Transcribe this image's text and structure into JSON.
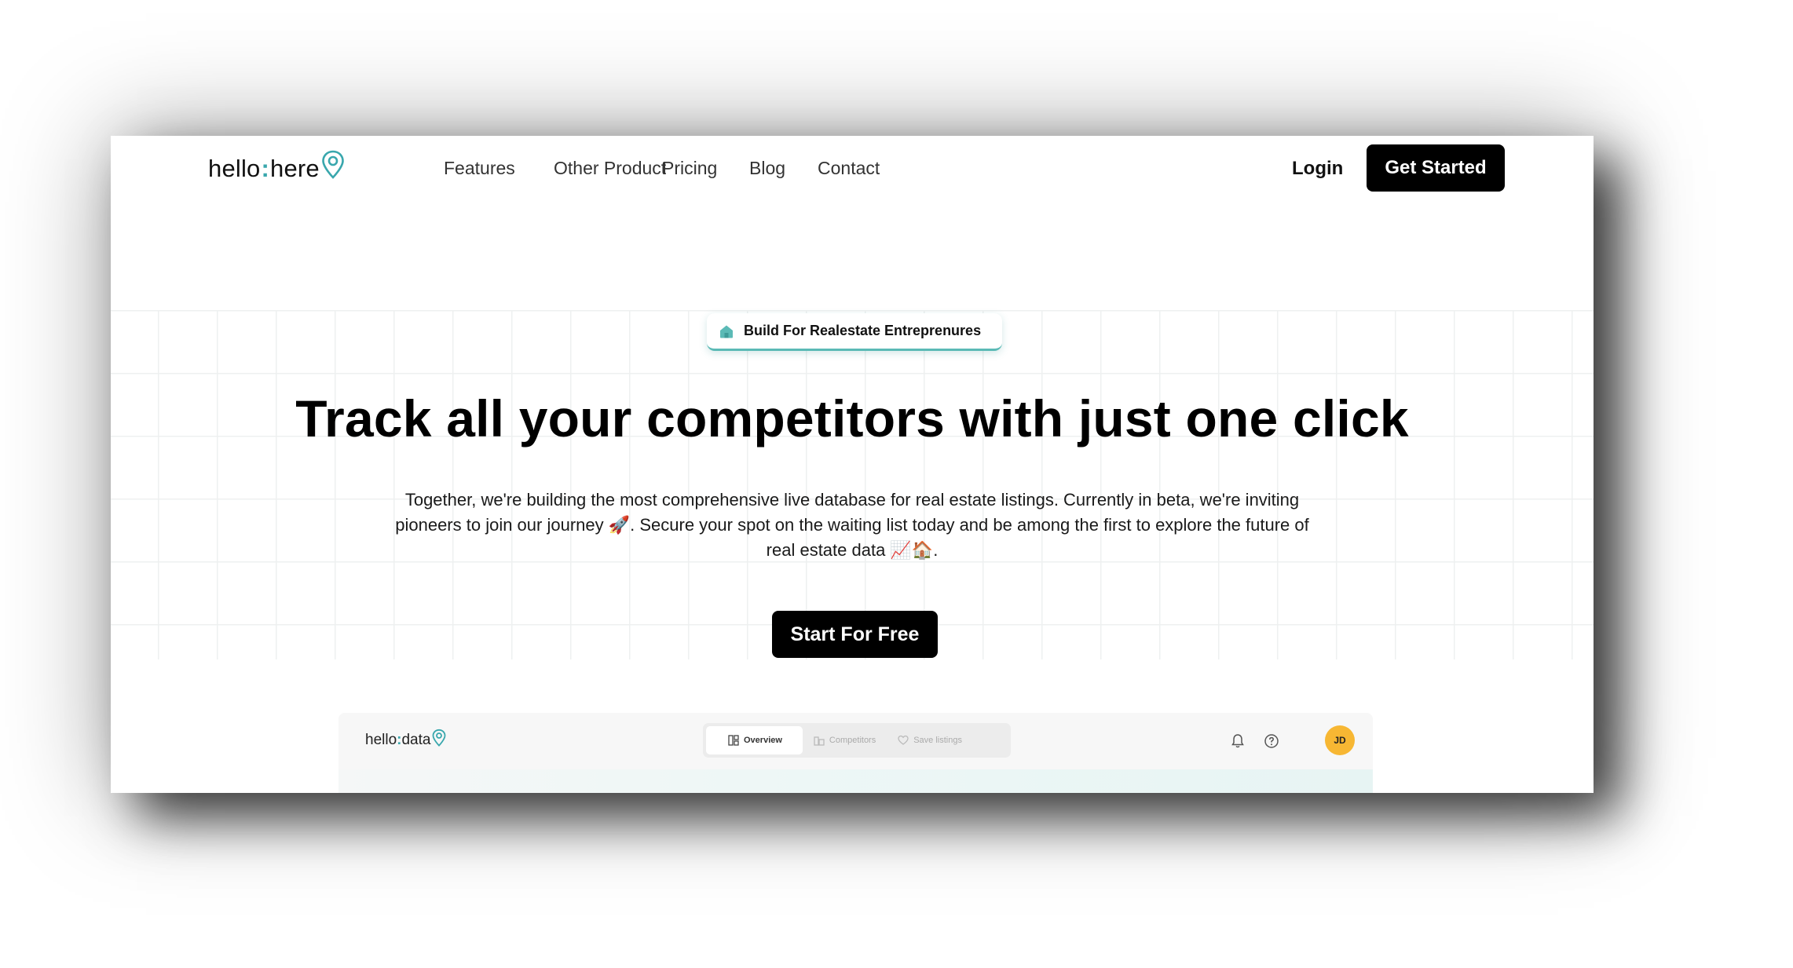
{
  "brand": {
    "name_part1": "hello",
    "separator": ":",
    "name_part2": "here"
  },
  "nav": {
    "links": [
      "Features",
      "Other Product",
      "Pricing",
      "Blog",
      "Contact"
    ],
    "login": "Login",
    "get_started": "Get Started"
  },
  "hero": {
    "badge": "Build For Realestate Entreprenures",
    "headline": "Track all your competitors with just one click",
    "subtext": "Together, we're building the most comprehensive live database for real estate listings. Currently in beta, we're inviting pioneers to join our journey 🚀. Secure your spot on the waiting list today and be among the first to explore the future of real estate data 📈🏠.",
    "cta": "Start For Free"
  },
  "preview": {
    "logo_part1": "hello",
    "logo_separator": ":",
    "logo_part2": "data",
    "tabs": [
      "Overview",
      "Competitors",
      "Save listings"
    ],
    "active_tab": "Overview",
    "avatar_initials": "JD",
    "icons": [
      "bell-icon",
      "help-icon"
    ]
  },
  "colors": {
    "brand_teal": "#39a7ad",
    "primary_button": "#000000",
    "avatar": "#f7b733"
  }
}
